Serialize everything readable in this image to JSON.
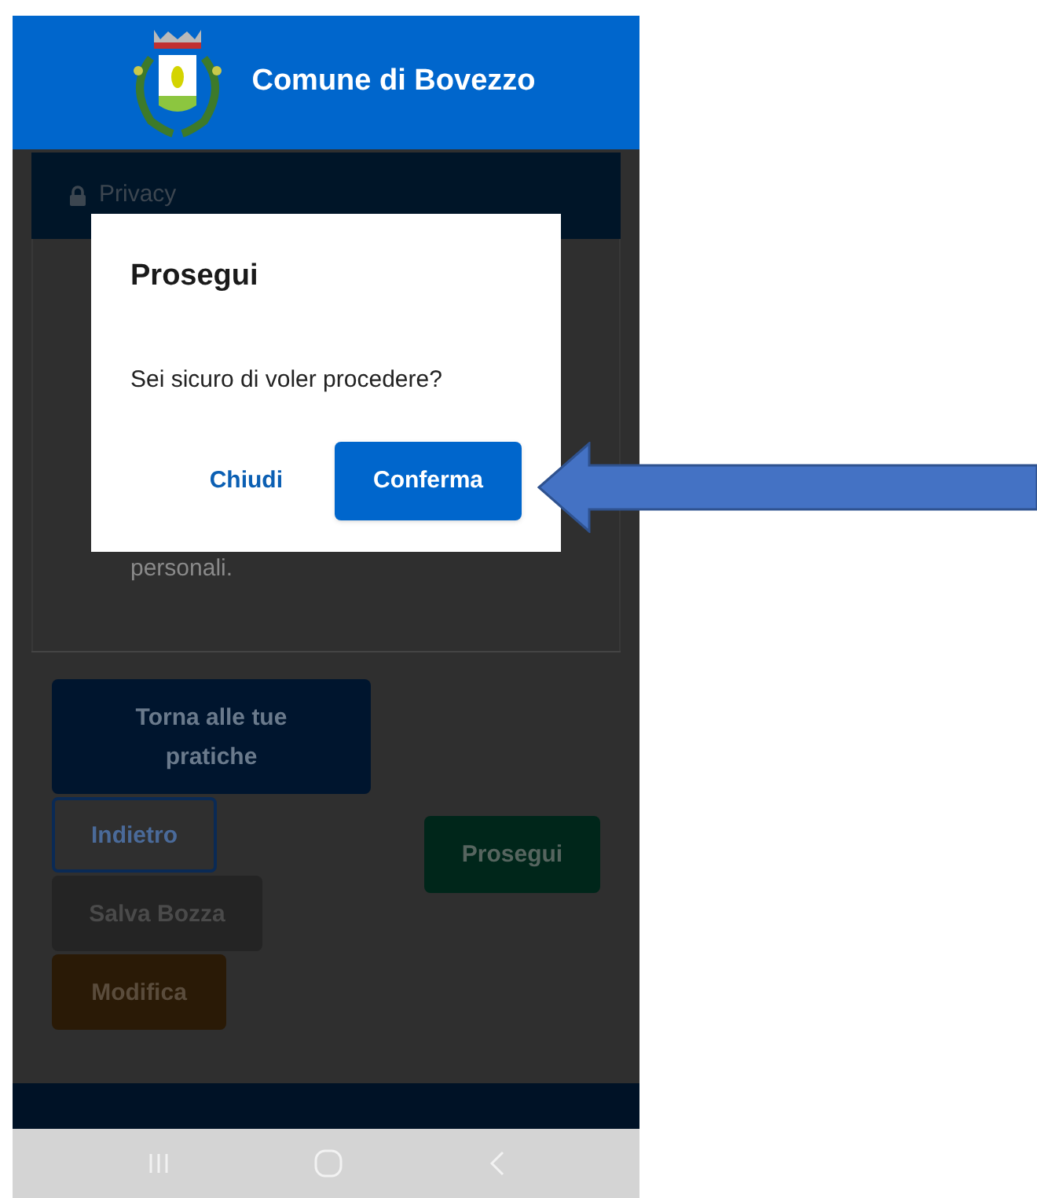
{
  "header": {
    "title": "Comune di Bovezzo"
  },
  "privacy_panel": {
    "title": "Privacy",
    "text_fragment": "personali."
  },
  "actions": {
    "left": [
      {
        "label": "Torna alle tue pratiche",
        "kind": "primary"
      },
      {
        "label": "Indietro",
        "kind": "outline"
      },
      {
        "label": "Salva Bozza",
        "kind": "dark"
      },
      {
        "label": "Modifica",
        "kind": "warning"
      }
    ],
    "right": [
      {
        "label": "Prosegui",
        "kind": "success"
      }
    ]
  },
  "dialog": {
    "title": "Prosegui",
    "message": "Sei sicuro di voler procedere?",
    "buttons": [
      {
        "label": "Chiudi",
        "kind": "link"
      },
      {
        "label": "Conferma",
        "kind": "primary"
      }
    ]
  }
}
